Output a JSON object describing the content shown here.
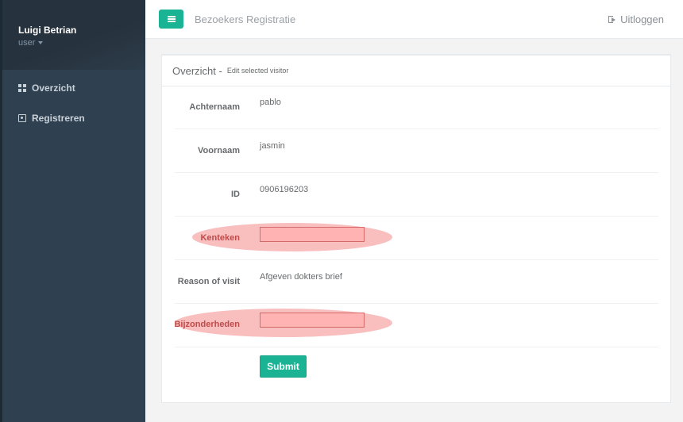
{
  "user": {
    "name": "Luigi Betrian",
    "role": "user"
  },
  "sidebar": {
    "items": [
      {
        "label": "Overzicht",
        "icon": "grid-icon"
      },
      {
        "label": "Registreren",
        "icon": "user-card-icon"
      }
    ]
  },
  "topbar": {
    "title": "Bezoekers Registratie",
    "logout_label": "Uitloggen"
  },
  "panel": {
    "title": "Overzicht -",
    "subtitle": "Edit selected visitor"
  },
  "form": {
    "rows": [
      {
        "label": "Achternaam",
        "value": "pablo"
      },
      {
        "label": "Voornaam",
        "value": "jasmin"
      },
      {
        "label": "ID",
        "value": "0906196203"
      },
      {
        "label": "Kenteken",
        "value": ""
      },
      {
        "label": "Reason of visit",
        "value": "Afgeven dokters brief"
      },
      {
        "label": "Bijzonderheden",
        "value": ""
      }
    ],
    "submit_label": "Submit"
  },
  "colors": {
    "accent": "#1ab394",
    "sidebar": "#2f4050",
    "highlight": "#f59696"
  }
}
